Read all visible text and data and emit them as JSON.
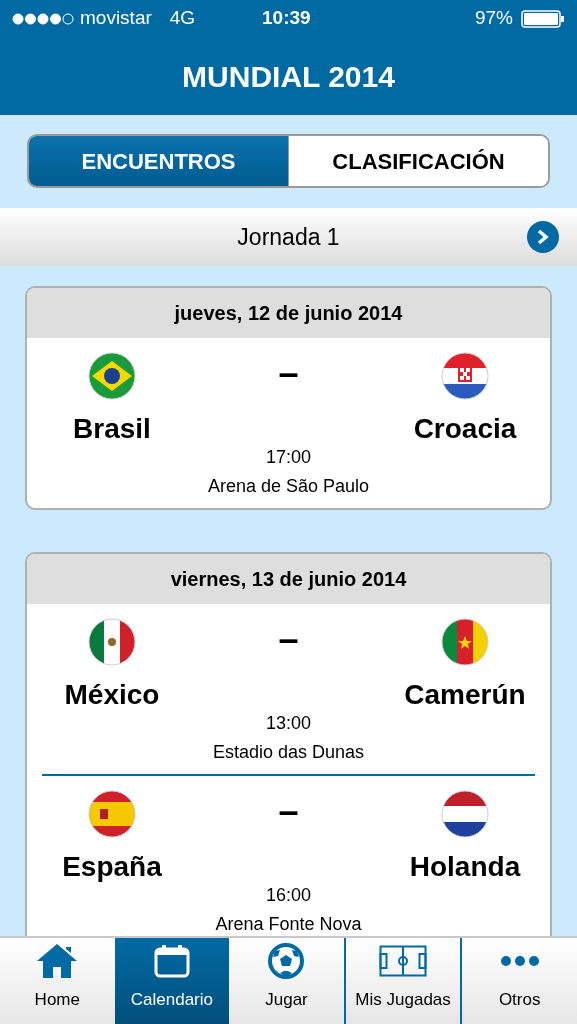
{
  "status_bar": {
    "carrier": "movistar",
    "network": "4G",
    "time": "10:39",
    "battery": "97%"
  },
  "header": {
    "title": "MUNDIAL 2014"
  },
  "tabs": [
    {
      "label": "ENCUENTROS",
      "selected": true
    },
    {
      "label": "CLASIFICACIÓN",
      "selected": false
    }
  ],
  "round": {
    "label": "Jornada 1"
  },
  "days": [
    {
      "date": "jueves, 12 de junio 2014",
      "matches": [
        {
          "home": "Brasil",
          "away": "Croacia",
          "separator": "–",
          "time": "17:00",
          "venue": "Arena de São Paulo"
        }
      ]
    },
    {
      "date": "viernes, 13 de junio 2014",
      "matches": [
        {
          "home": "México",
          "away": "Camerún",
          "separator": "–",
          "time": "13:00",
          "venue": "Estadio das Dunas"
        },
        {
          "home": "España",
          "away": "Holanda",
          "separator": "–",
          "time": "16:00",
          "venue": "Arena Fonte Nova"
        }
      ]
    }
  ],
  "nav": [
    {
      "label": "Home",
      "selected": false
    },
    {
      "label": "Calendario",
      "selected": true
    },
    {
      "label": "Jugar",
      "selected": false
    },
    {
      "label": "Mis Jugadas",
      "selected": false
    },
    {
      "label": "Otros",
      "selected": false
    }
  ]
}
